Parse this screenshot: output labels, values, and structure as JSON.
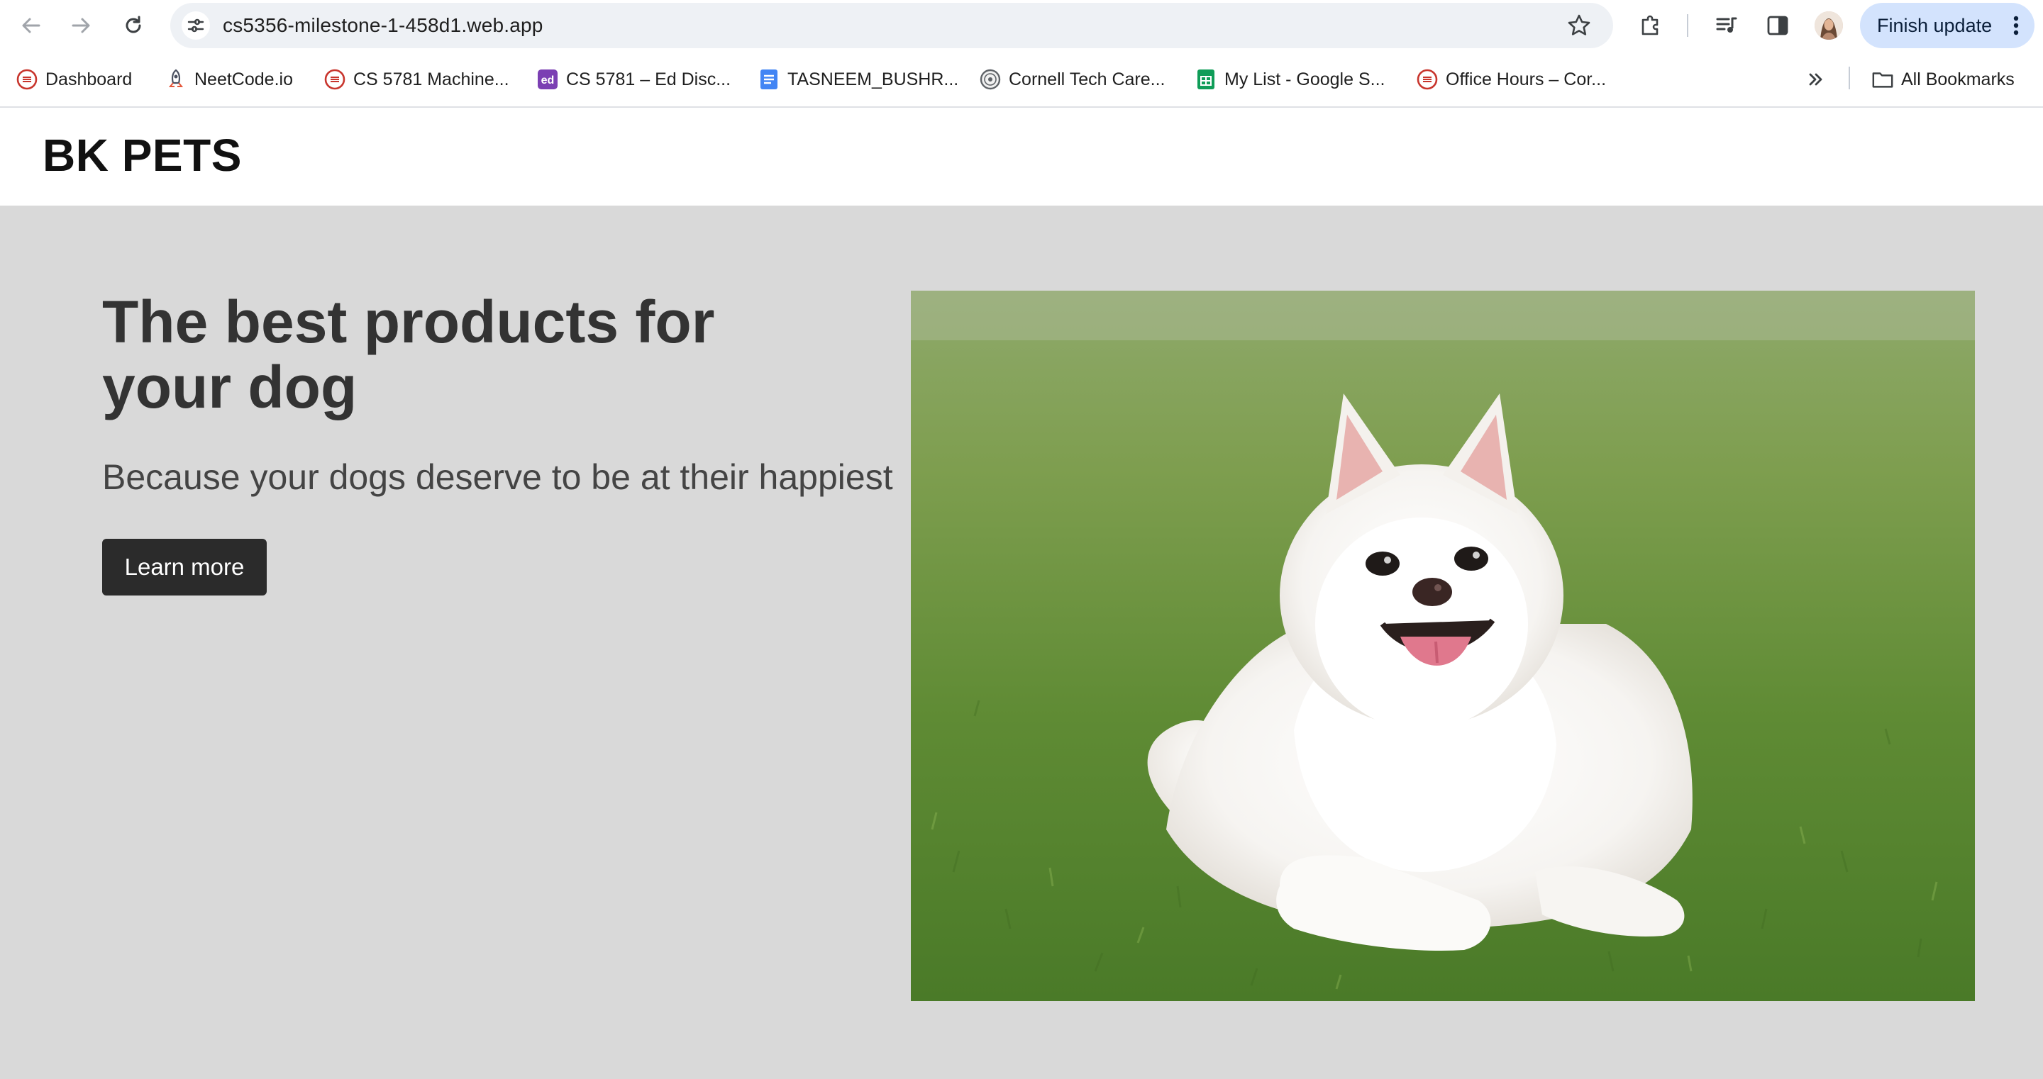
{
  "browser": {
    "url": "cs5356-milestone-1-458d1.web.app",
    "update_button": "Finish update"
  },
  "bookmarks": [
    {
      "label": "Dashboard",
      "icon": "canvas-icon"
    },
    {
      "label": "NeetCode.io",
      "icon": "rocket-icon"
    },
    {
      "label": "CS 5781 Machine...",
      "icon": "canvas-icon"
    },
    {
      "label": "CS 5781 – Ed Disc...",
      "icon": "ed-icon"
    },
    {
      "label": "TASNEEM_BUSHR...",
      "icon": "google-docs-icon"
    },
    {
      "label": "Cornell Tech Care...",
      "icon": "seal-icon"
    },
    {
      "label": "My List - Google S...",
      "icon": "google-sheets-icon"
    },
    {
      "label": "Office Hours – Cor...",
      "icon": "canvas-icon"
    }
  ],
  "all_bookmarks": "All Bookmarks",
  "site": {
    "brand": "BK PETS",
    "hero": {
      "title": "The best products for your dog",
      "subtitle": "Because your dogs deserve to be at their happiest",
      "button": "Learn more"
    }
  },
  "colors": {
    "hero_background": "#d9d9d9",
    "button_background": "#2b2b2b",
    "update_pill": "#d3e3fd"
  }
}
